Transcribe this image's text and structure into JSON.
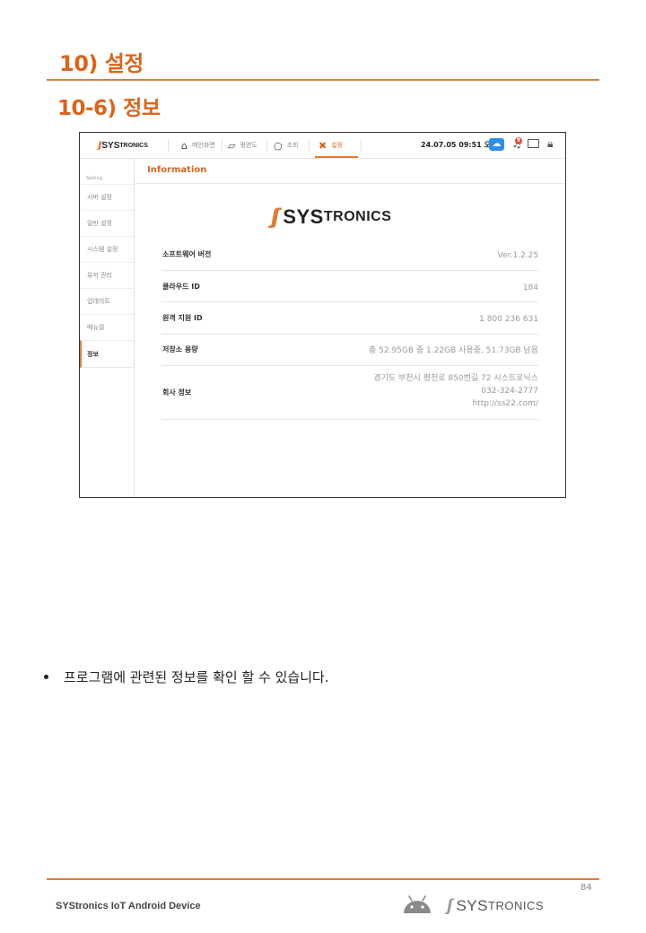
{
  "document": {
    "heading1": "10) 설정",
    "heading2": "10-6) 정보",
    "bullet_text": "프로그램에 관련된 정보를 확인 할 수 있습니다.",
    "page_number": "84",
    "footer_text": "SYStronics IoT Android Device"
  },
  "app": {
    "logo_sys": "SYS",
    "logo_tronics": "TRONICS",
    "nav": [
      {
        "label": "메인화면",
        "icon": "home-icon"
      },
      {
        "label": "평면도",
        "icon": "floorplan-icon"
      },
      {
        "label": "조회",
        "icon": "search-icon"
      },
      {
        "label": "설정",
        "icon": "tools-icon",
        "active": true
      }
    ],
    "datetime": "24.07.05 09:51 오전",
    "notification_count": "9",
    "sidebar": {
      "heading": "Setting",
      "items": [
        "서버 설정",
        "일반 설정",
        "시스템 설정",
        "유저 관리",
        "업데이트",
        "매뉴얼",
        "정보"
      ],
      "active_index": 6
    },
    "content": {
      "title": "Information",
      "rows": [
        {
          "label": "소프트웨어 버전",
          "value": "Ver.1.2.25"
        },
        {
          "label": "클라우드 ID",
          "value": "184"
        },
        {
          "label": "원격 지원 ID",
          "value": "1 800 236 631"
        },
        {
          "label": "저장소 용량",
          "value": "총 52.95GB 중 1.22GB 사용중, 51.73GB 남음"
        },
        {
          "label": "회사 정보",
          "value_lines": [
            "경기도 부천시 평천로 850번길 72 시스트로닉스",
            "032-324-2777",
            "http://ss22.com/"
          ]
        }
      ]
    }
  },
  "colors": {
    "accent": "#e07b39",
    "heading": "#d9651e",
    "cloud": "#2f8fe6"
  }
}
